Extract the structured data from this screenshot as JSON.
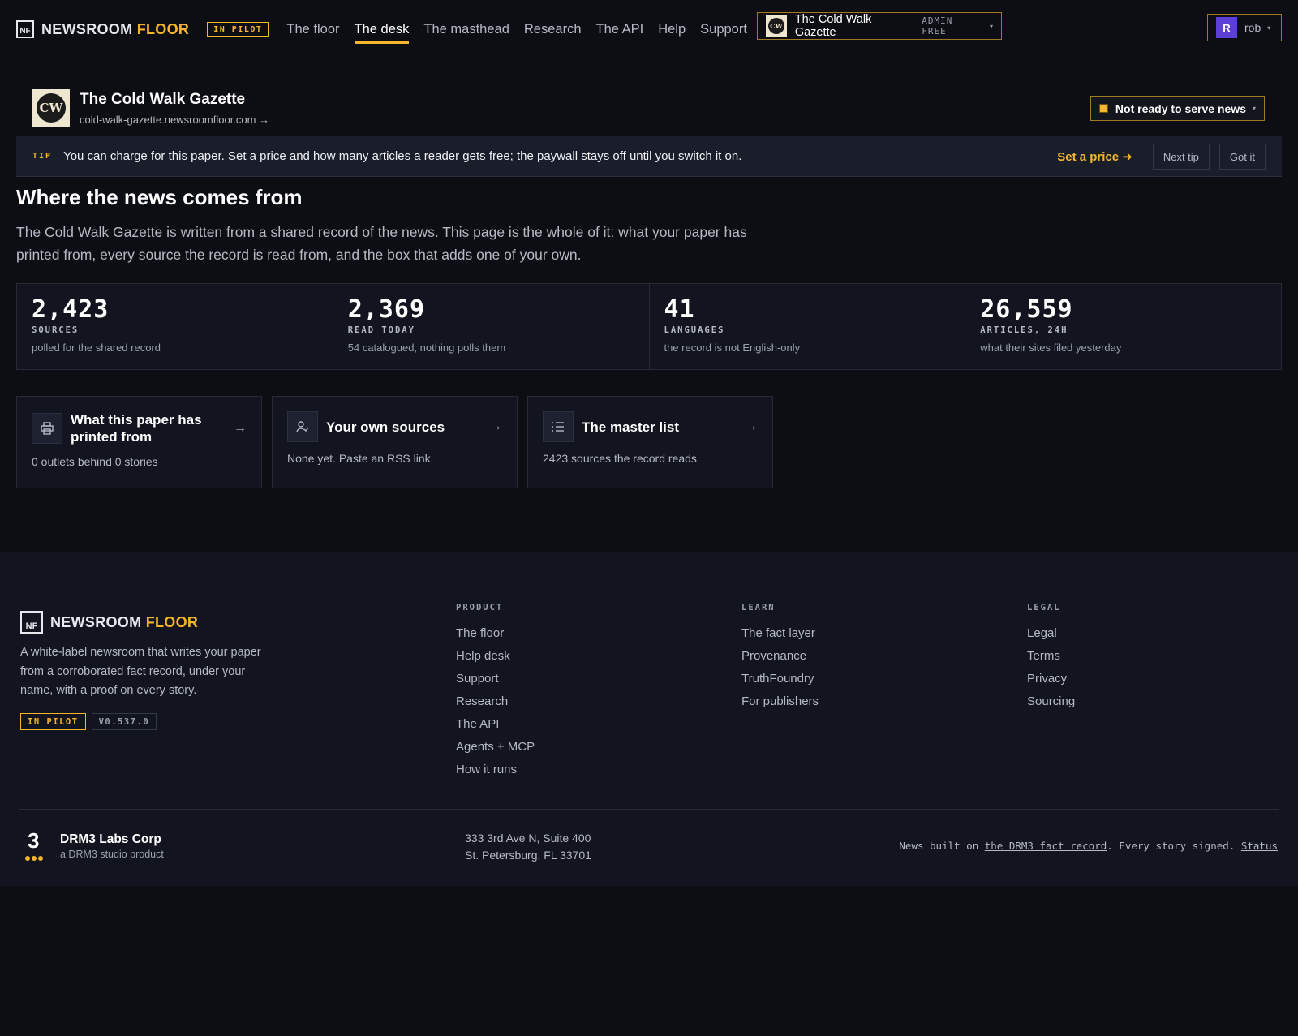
{
  "nav": {
    "brand_first": "NEWSROOM",
    "brand_second": "FLOOR",
    "brand_mark": "NF",
    "pilot_badge": "IN PILOT",
    "links": [
      {
        "label": "The floor",
        "active": false
      },
      {
        "label": "The desk",
        "active": true
      },
      {
        "label": "The masthead",
        "active": false
      },
      {
        "label": "Research",
        "active": false
      },
      {
        "label": "The API",
        "active": false
      },
      {
        "label": "Help",
        "active": false
      },
      {
        "label": "Support",
        "active": false
      }
    ],
    "paper_switcher": {
      "logo": "CW",
      "name": "The Cold Walk Gazette",
      "meta": "ADMIN FREE",
      "icon": "chevron-down-icon"
    },
    "user": {
      "initial": "R",
      "name": "rob",
      "icon": "chevron-down-icon"
    }
  },
  "paper": {
    "logo": "CW",
    "name": "The Cold Walk Gazette",
    "url": "cold-walk-gazette.newsroomfloor.com →",
    "status": "Not ready to serve news",
    "status_color": "#f5b62a"
  },
  "tip": {
    "tag": "TIP",
    "text": "You can charge for this paper. Set a price and how many articles a reader gets free; the paywall stays off until you switch it on.",
    "cta": "Set a price ➜",
    "next": "Next tip",
    "dismiss": "Got it"
  },
  "section": {
    "title": "Where the news comes from",
    "intro": "The Cold Walk Gazette is written from a shared record of the news. This page is the whole of it: what your paper has printed from, every source the record is read from, and the box that adds one of your own."
  },
  "stats": [
    {
      "value": "2,423",
      "label": "SOURCES",
      "sub": "polled for the shared record"
    },
    {
      "value": "2,369",
      "label": "READ TODAY",
      "sub": "54 catalogued, nothing polls them"
    },
    {
      "value": "41",
      "label": "LANGUAGES",
      "sub": "the record is not English-only"
    },
    {
      "value": "26,559",
      "label": "ARTICLES, 24H",
      "sub": "what their sites filed yesterday"
    }
  ],
  "cards": [
    {
      "icon": "printer-icon",
      "title": "What this paper has printed from",
      "sub": "0 outlets behind 0 stories"
    },
    {
      "icon": "user-source-icon",
      "title": "Your own sources",
      "sub": "None yet. Paste an RSS link."
    },
    {
      "icon": "list-icon",
      "title": "The master list",
      "sub": "2423 sources the record reads"
    }
  ],
  "footer": {
    "brand_first": "NEWSROOM",
    "brand_second": "FLOOR",
    "description": "A white-label newsroom that writes your paper from a corroborated fact record, under your name, with a proof on every story.",
    "pilot_badge": "IN PILOT",
    "version": "V0.537.0",
    "columns": [
      {
        "title": "PRODUCT",
        "links": [
          "The floor",
          "Help desk",
          "Support",
          "Research",
          "The API",
          "Agents + MCP",
          "How it runs"
        ]
      },
      {
        "title": "LEARN",
        "links": [
          "The fact layer",
          "Provenance",
          "TruthFoundry",
          "For publishers"
        ]
      },
      {
        "title": "LEGAL",
        "links": [
          "Legal",
          "Terms",
          "Privacy",
          "Sourcing"
        ]
      }
    ],
    "company": {
      "logo": "3",
      "name": "DRM3 Labs Corp",
      "sub": "a DRM3 studio product"
    },
    "address": [
      "333 3rd Ave N, Suite 400",
      "St. Petersburg, FL 33701"
    ],
    "note": {
      "prefix": "News built on ",
      "link": "the DRM3 fact record",
      "middle": ". Every story signed. ",
      "status": "Status"
    }
  },
  "colors": {
    "accent": "#f5b62a",
    "background": "#0c0e14",
    "avatar": "#5b3fd6"
  }
}
